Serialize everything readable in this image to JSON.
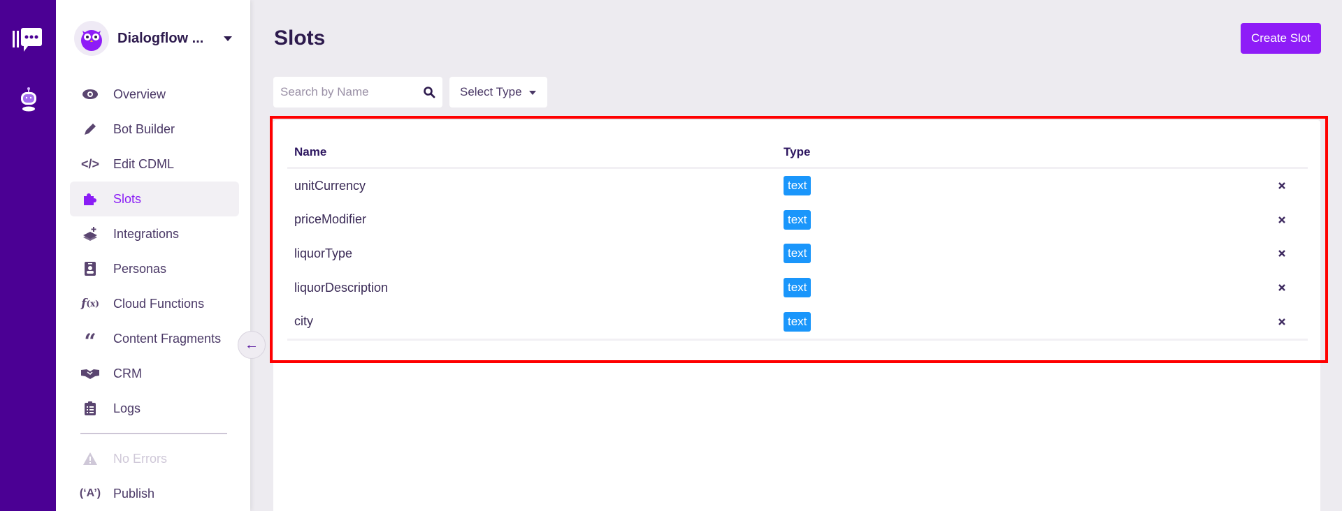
{
  "project": {
    "name": "Dialogflow ..."
  },
  "sidebar": {
    "items": [
      {
        "label": "Overview",
        "icon": "eye-icon"
      },
      {
        "label": "Bot Builder",
        "icon": "pencil-icon"
      },
      {
        "label": "Edit CDML",
        "icon": "code-icon"
      },
      {
        "label": "Slots",
        "icon": "puzzle-icon",
        "active": true
      },
      {
        "label": "Integrations",
        "icon": "layers-plus-icon"
      },
      {
        "label": "Personas",
        "icon": "id-badge-icon"
      },
      {
        "label": "Cloud Functions",
        "icon": "function-icon"
      },
      {
        "label": "Content Fragments",
        "icon": "quote-icon"
      },
      {
        "label": "CRM",
        "icon": "handshake-icon"
      },
      {
        "label": "Logs",
        "icon": "clipboard-list-icon"
      }
    ],
    "bottom": [
      {
        "label": "No Errors",
        "icon": "warning-icon",
        "disabled": true
      },
      {
        "label": "Publish",
        "icon": "broadcast-icon"
      }
    ]
  },
  "header": {
    "title": "Slots",
    "create_label": "Create Slot"
  },
  "filters": {
    "search_placeholder": "Search by Name",
    "search_value": "",
    "type_select": "Select Type"
  },
  "table": {
    "columns": [
      "Name",
      "Type"
    ],
    "rows": [
      {
        "name": "unitCurrency",
        "type": "text"
      },
      {
        "name": "priceModifier",
        "type": "text"
      },
      {
        "name": "liquorType",
        "type": "text"
      },
      {
        "name": "liquorDescription",
        "type": "text"
      },
      {
        "name": "city",
        "type": "text"
      }
    ]
  },
  "colors": {
    "rail": "#4b0094",
    "accent": "#8e1cf7",
    "badge": "#1a96fb",
    "highlight": "#ff0000"
  }
}
